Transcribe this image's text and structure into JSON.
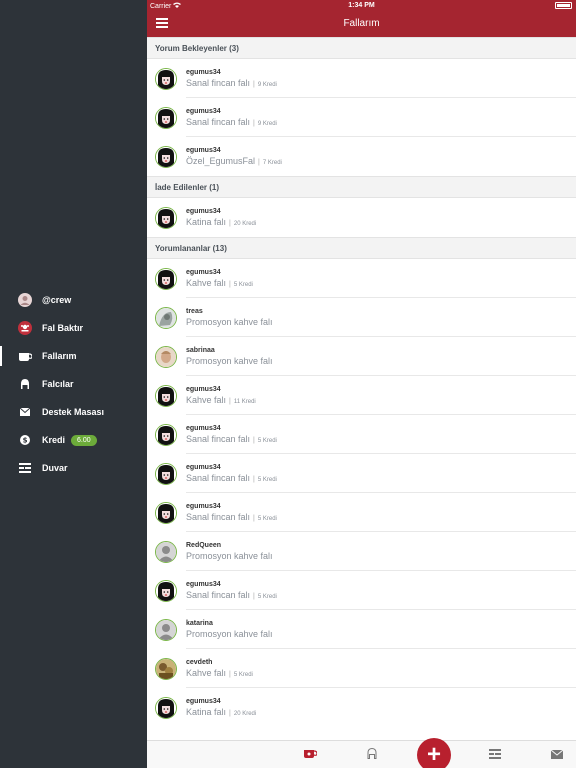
{
  "sidebar": {
    "items": [
      {
        "icon": "user-avatar-icon",
        "label": "@crew"
      },
      {
        "icon": "fal-baktir-icon",
        "label": "Fal Baktır"
      },
      {
        "icon": "fallarim-icon",
        "label": "Fallarım"
      },
      {
        "icon": "falcilar-icon",
        "label": "Falcılar"
      },
      {
        "icon": "envelope-icon",
        "label": "Destek Masası"
      },
      {
        "icon": "credit-icon",
        "label": "Kredi",
        "badge": "6.00"
      },
      {
        "icon": "wall-icon",
        "label": "Duvar"
      }
    ]
  },
  "status_bar": {
    "carrier": "Carrier",
    "time": "1:34 PM"
  },
  "header": {
    "title": "Fallarım"
  },
  "sections": [
    {
      "title": "Yorum Bekleyenler  (3)",
      "rows": [
        {
          "user": "egumus34",
          "type": "Sanal fincan falı",
          "credit": "9 Kredi"
        },
        {
          "user": "egumus34",
          "type": "Sanal fincan falı",
          "credit": "9 Kredi"
        },
        {
          "user": "egumus34",
          "type": "Özel_EgumusFal",
          "credit": "7 Kredi"
        }
      ]
    },
    {
      "title": "İade Edilenler  (1)",
      "rows": [
        {
          "user": "egumus34",
          "type": "Katina falı",
          "credit": "20 Kredi"
        }
      ]
    },
    {
      "title": "Yorumlananlar  (13)",
      "rows": [
        {
          "user": "egumus34",
          "type": "Kahve falı",
          "credit": "5 Kredi"
        },
        {
          "user": "treas",
          "type": "Promosyon kahve falı",
          "credit": ""
        },
        {
          "user": "sabrinaa",
          "type": "Promosyon kahve falı",
          "credit": ""
        },
        {
          "user": "egumus34",
          "type": "Kahve falı",
          "credit": "11 Kredi"
        },
        {
          "user": "egumus34",
          "type": "Sanal fincan falı",
          "credit": "5 Kredi"
        },
        {
          "user": "egumus34",
          "type": "Sanal fincan falı",
          "credit": "5 Kredi"
        },
        {
          "user": "egumus34",
          "type": "Sanal fincan falı",
          "credit": "5 Kredi"
        },
        {
          "user": "RedQueen",
          "type": "Promosyon kahve falı",
          "credit": ""
        },
        {
          "user": "egumus34",
          "type": "Sanal fincan falı",
          "credit": "5 Kredi"
        },
        {
          "user": "katarina",
          "type": "Promosyon kahve falı",
          "credit": ""
        },
        {
          "user": "cevdeth",
          "type": "Kahve falı",
          "credit": "5 Kredi"
        },
        {
          "user": "egumus34",
          "type": "Katina falı",
          "credit": "20 Kredi"
        }
      ]
    }
  ],
  "tabbar": {
    "fab_label": "+"
  },
  "colors": {
    "accent": "#a52530",
    "sidebar": "#2d3339",
    "badge": "#6cab3a",
    "avatar_ring": "#7ab648"
  }
}
